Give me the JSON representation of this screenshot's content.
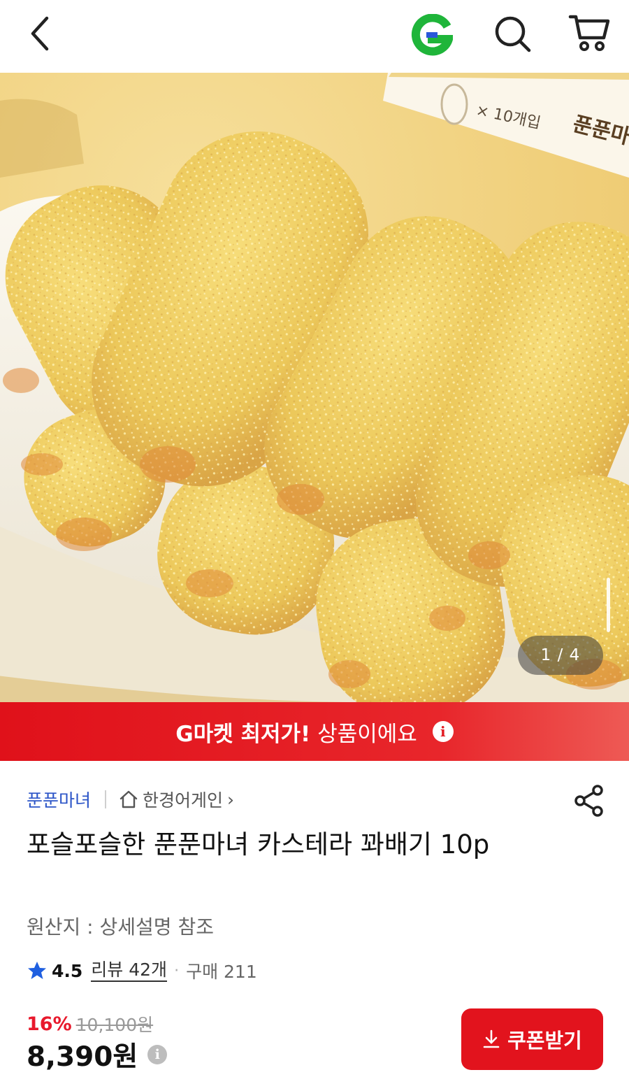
{
  "header": {
    "back_icon": "chevron-left-icon",
    "logo_letter": "G",
    "search_icon": "search-icon",
    "cart_icon": "cart-icon"
  },
  "hero": {
    "package_text": "× 10개입",
    "package_brand": "푼푼마",
    "counter": "1 / 4"
  },
  "banner": {
    "bold_text": "G마켓 최저가!",
    "text": "상품이에요",
    "info_icon": "i"
  },
  "product": {
    "brand": "푼푼마녀",
    "store": "한경어게인",
    "store_chevron": "›",
    "title": "포슬포슬한 푼푼마녀 카스테라 꽈배기 10p",
    "origin": "원산지 : 상세설명 참조",
    "rating": "4.5",
    "reviews": "리뷰 42개",
    "dot": "·",
    "purchases": "구매 211",
    "discount": "16%",
    "original_price": "10,100원",
    "price": "8,390원",
    "price_info": "i",
    "coupon_label": "쿠폰받기"
  },
  "colors": {
    "accent_red": "#e2131d",
    "brand_blue": "#2b54c7",
    "star_blue": "#1f5fe0",
    "g_green": "#1fb53a"
  }
}
